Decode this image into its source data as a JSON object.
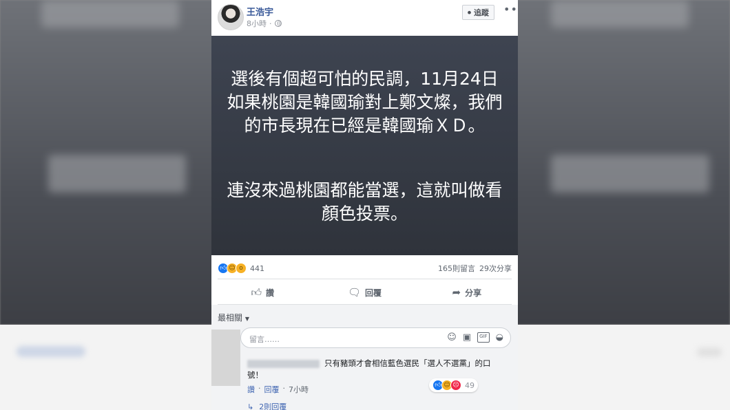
{
  "post": {
    "author": "王浩宇",
    "time": "8小時",
    "follow_label": "追蹤",
    "paragraph1": "選後有個超可怕的民調，11月24日如果桃園是韓國瑜對上鄭文燦，我們的市長現在已經是韓國瑜ＸＤ。",
    "paragraph2": "連沒來過桃園都能當選，這就叫做看顏色投票。"
  },
  "stats": {
    "reaction_count": "441",
    "comments": "165則留言",
    "shares": "29次分享"
  },
  "actions": {
    "like": "讚",
    "comment": "回覆",
    "share": "分享"
  },
  "comments": {
    "sort_label": "最相關",
    "input_placeholder": "留言……",
    "first": {
      "text": "只有豬頭才會相信藍色選民「選人不選黨」的口號！",
      "reaction_count": "49",
      "like": "讚",
      "reply": "回覆",
      "time": "7小時"
    },
    "view_replies": "2則回覆"
  },
  "colors": {
    "link": "#385898",
    "post_bg": "#353a44",
    "like_blue": "#1877f2"
  }
}
